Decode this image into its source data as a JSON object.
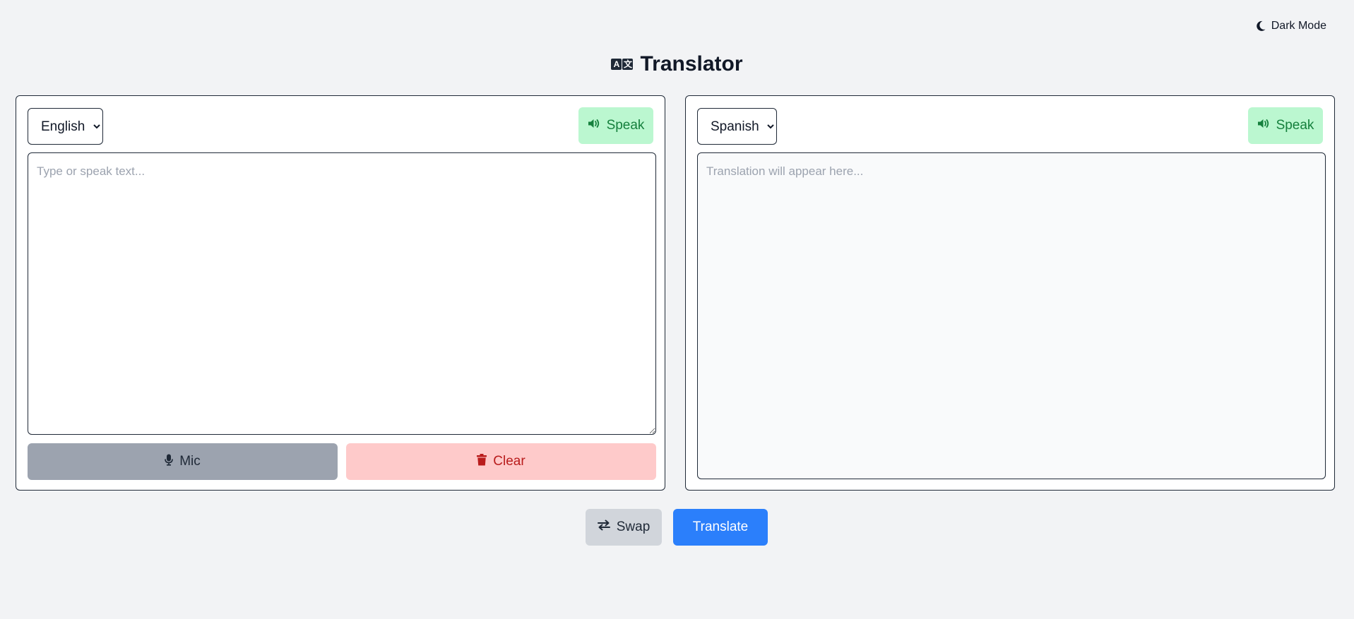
{
  "header": {
    "dark_mode_label": "Dark Mode",
    "title": "Translator",
    "title_icon_glyphs": [
      "A",
      "文"
    ]
  },
  "source": {
    "language": "English",
    "speak_label": "Speak",
    "placeholder": "Type or speak text...",
    "mic_label": "Mic",
    "clear_label": "Clear"
  },
  "target": {
    "language": "Spanish",
    "speak_label": "Speak",
    "placeholder": "Translation will appear here..."
  },
  "actions": {
    "swap_label": "Swap",
    "translate_label": "Translate"
  },
  "icons": {
    "dark_mode": "moon-icon",
    "title": "translate-icon",
    "speak": "speaker-icon",
    "mic": "microphone-icon",
    "clear": "trash-icon",
    "swap": "swap-arrows-icon"
  },
  "colors": {
    "background": "#f2f3f5",
    "speak_bg": "#bbf7d0",
    "speak_text": "#15803d",
    "mic_bg": "#9ca3af",
    "clear_bg": "#fecaca",
    "clear_text": "#b91c1c",
    "swap_bg": "#d1d5db",
    "translate_bg": "#2b7ffb"
  }
}
